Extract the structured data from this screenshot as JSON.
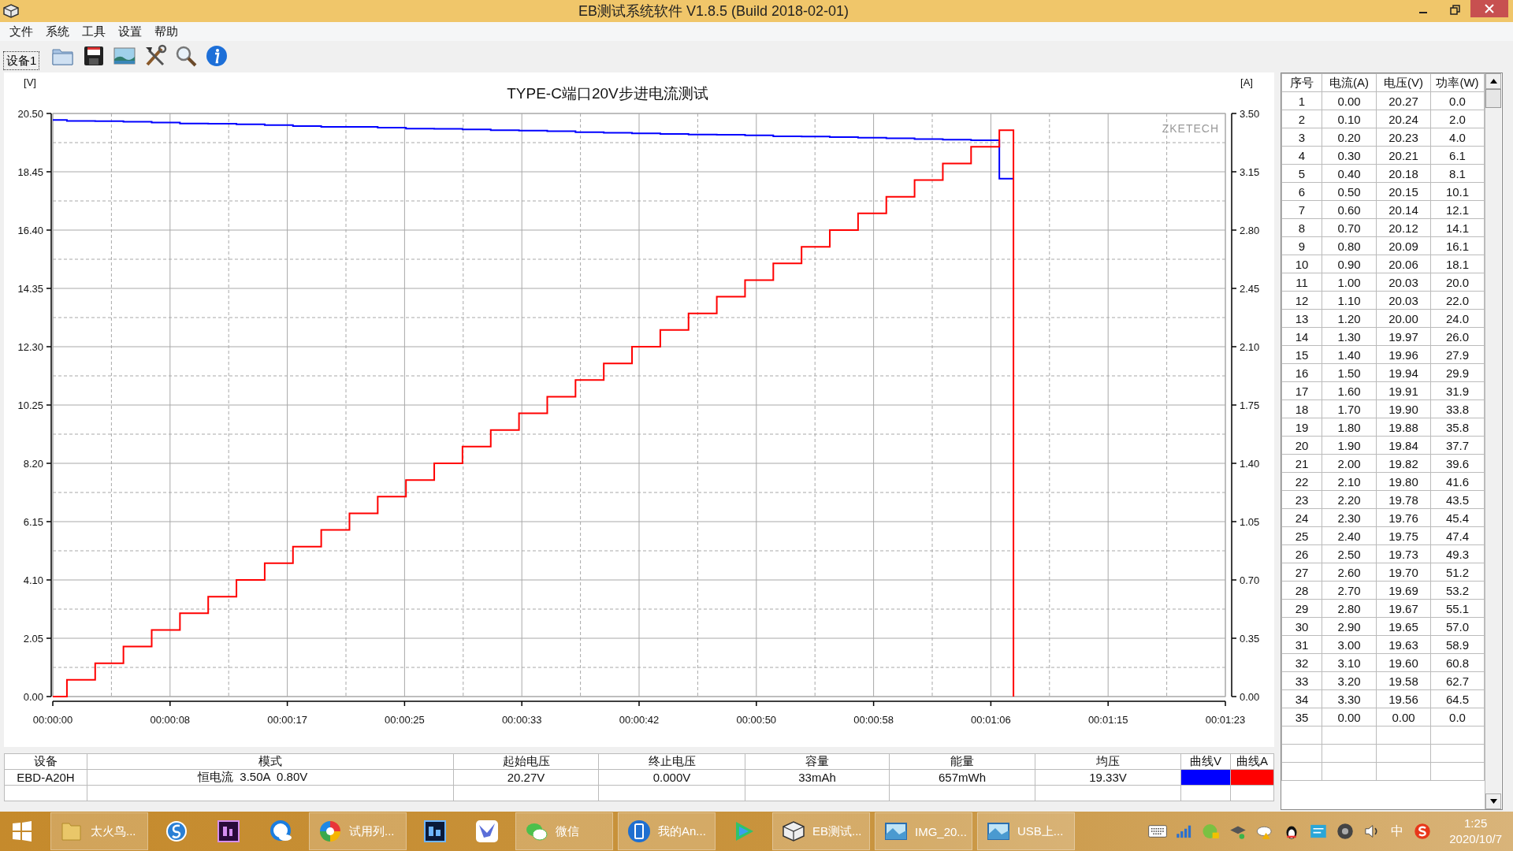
{
  "window": {
    "title": "EB测试系统软件 V1.8.5 (Build 2018-02-01)"
  },
  "menu": [
    "文件",
    "系统",
    "工具",
    "设置",
    "帮助"
  ],
  "toolbar": {
    "device_tab": "设备1"
  },
  "chart": {
    "brand": "ZKETECH",
    "chart_data": {
      "type": "line",
      "title": "TYPE-C端口20V步进电流测试",
      "ylabel": "[V]",
      "y2label": "[A]",
      "xlim": [
        0,
        83
      ],
      "ylim": [
        0,
        20.5
      ],
      "y2lim": [
        0,
        3.5
      ],
      "xticks": [
        {
          "value": 0,
          "label": "00:00:00"
        },
        {
          "value": 8.3,
          "label": "00:00:08"
        },
        {
          "value": 16.6,
          "label": "00:00:17"
        },
        {
          "value": 24.9,
          "label": "00:00:25"
        },
        {
          "value": 33.2,
          "label": "00:00:33"
        },
        {
          "value": 41.5,
          "label": "00:00:42"
        },
        {
          "value": 49.8,
          "label": "00:00:50"
        },
        {
          "value": 58.1,
          "label": "00:00:58"
        },
        {
          "value": 66.4,
          "label": "00:01:06"
        },
        {
          "value": 74.7,
          "label": "00:01:15"
        },
        {
          "value": 83,
          "label": "00:01:23"
        }
      ],
      "yticks": [
        {
          "value": 0,
          "label": "0.00"
        },
        {
          "value": 2.05,
          "label": "2.05"
        },
        {
          "value": 4.1,
          "label": "4.10"
        },
        {
          "value": 6.15,
          "label": "6.15"
        },
        {
          "value": 8.2,
          "label": "8.20"
        },
        {
          "value": 10.25,
          "label": "10.25"
        },
        {
          "value": 12.3,
          "label": "12.30"
        },
        {
          "value": 14.35,
          "label": "14.35"
        },
        {
          "value": 16.4,
          "label": "16.40"
        },
        {
          "value": 18.45,
          "label": "18.45"
        },
        {
          "value": 20.5,
          "label": "20.50"
        }
      ],
      "y2ticks": [
        {
          "value": 0,
          "label": "0.00"
        },
        {
          "value": 0.35,
          "label": "0.35"
        },
        {
          "value": 0.7,
          "label": "0.70"
        },
        {
          "value": 1.05,
          "label": "1.05"
        },
        {
          "value": 1.4,
          "label": "1.40"
        },
        {
          "value": 1.75,
          "label": "1.75"
        },
        {
          "value": 2.1,
          "label": "2.10"
        },
        {
          "value": 2.45,
          "label": "2.45"
        },
        {
          "value": 2.8,
          "label": "2.80"
        },
        {
          "value": 3.15,
          "label": "3.15"
        },
        {
          "value": 3.5,
          "label": "3.50"
        }
      ],
      "grid": true,
      "x": [
        0,
        1,
        1,
        3,
        3,
        5,
        5,
        7,
        7,
        9,
        9,
        11,
        11,
        13,
        13,
        15,
        15,
        17,
        17,
        19,
        19,
        21,
        21,
        23,
        23,
        25,
        25,
        27,
        27,
        29,
        29,
        31,
        31,
        33,
        33,
        35,
        35,
        37,
        37,
        39,
        39,
        41,
        41,
        43,
        43,
        45,
        45,
        47,
        47,
        49,
        49,
        51,
        51,
        53,
        53,
        55,
        55,
        57,
        57,
        59,
        59,
        61,
        61,
        63,
        63,
        65,
        65,
        67,
        67,
        68,
        68
      ],
      "series": [
        {
          "color": "#0000ff",
          "values": [
            20.27,
            20.27,
            20.24,
            20.24,
            20.23,
            20.23,
            20.21,
            20.21,
            20.18,
            20.18,
            20.15,
            20.15,
            20.14,
            20.14,
            20.12,
            20.12,
            20.09,
            20.09,
            20.06,
            20.06,
            20.03,
            20.03,
            20.03,
            20.03,
            20.0,
            20.0,
            19.97,
            19.97,
            19.96,
            19.96,
            19.94,
            19.94,
            19.91,
            19.91,
            19.9,
            19.9,
            19.88,
            19.88,
            19.84,
            19.84,
            19.82,
            19.82,
            19.8,
            19.8,
            19.78,
            19.78,
            19.76,
            19.76,
            19.75,
            19.75,
            19.73,
            19.73,
            19.7,
            19.7,
            19.69,
            19.69,
            19.67,
            19.67,
            19.65,
            19.65,
            19.63,
            19.63,
            19.6,
            19.6,
            19.58,
            19.58,
            19.56,
            19.56,
            18.21,
            18.21,
            18.21
          ]
        },
        {
          "axis": "y2",
          "color": "#ff0000",
          "values": [
            0,
            0,
            0.1,
            0.1,
            0.2,
            0.2,
            0.3,
            0.3,
            0.4,
            0.4,
            0.5,
            0.5,
            0.6,
            0.6,
            0.7,
            0.7,
            0.8,
            0.8,
            0.9,
            0.9,
            1.0,
            1.0,
            1.1,
            1.1,
            1.2,
            1.2,
            1.3,
            1.3,
            1.4,
            1.4,
            1.5,
            1.5,
            1.6,
            1.6,
            1.7,
            1.7,
            1.8,
            1.8,
            1.9,
            1.9,
            2.0,
            2.0,
            2.1,
            2.1,
            2.2,
            2.2,
            2.3,
            2.3,
            2.4,
            2.4,
            2.5,
            2.5,
            2.6,
            2.6,
            2.7,
            2.7,
            2.8,
            2.8,
            2.9,
            2.9,
            3.0,
            3.0,
            3.1,
            3.1,
            3.2,
            3.2,
            3.3,
            3.3,
            3.4,
            3.4,
            0
          ]
        }
      ]
    }
  },
  "summary": {
    "columns": [
      "设备",
      "模式",
      "起始电压",
      "终止电压",
      "容量",
      "能量",
      "均压",
      "曲线V",
      "曲线A"
    ],
    "row": {
      "device": "EBD-A20H",
      "mode": "恒电流  3.50A  0.80V",
      "start_voltage": "20.27V",
      "end_voltage": "0.000V",
      "capacity": "33mAh",
      "energy": "657mWh",
      "avg_voltage": "19.33V"
    },
    "curves": [
      {
        "color": "#0000ff"
      },
      {
        "color": "#ff0000"
      }
    ]
  },
  "readings": {
    "columns": [
      "序号",
      "电流(A)",
      "电压(V)",
      "功率(W)"
    ],
    "rows": [
      [
        "1",
        "0.00",
        "20.27",
        "0.0"
      ],
      [
        "2",
        "0.10",
        "20.24",
        "2.0"
      ],
      [
        "3",
        "0.20",
        "20.23",
        "4.0"
      ],
      [
        "4",
        "0.30",
        "20.21",
        "6.1"
      ],
      [
        "5",
        "0.40",
        "20.18",
        "8.1"
      ],
      [
        "6",
        "0.50",
        "20.15",
        "10.1"
      ],
      [
        "7",
        "0.60",
        "20.14",
        "12.1"
      ],
      [
        "8",
        "0.70",
        "20.12",
        "14.1"
      ],
      [
        "9",
        "0.80",
        "20.09",
        "16.1"
      ],
      [
        "10",
        "0.90",
        "20.06",
        "18.1"
      ],
      [
        "11",
        "1.00",
        "20.03",
        "20.0"
      ],
      [
        "12",
        "1.10",
        "20.03",
        "22.0"
      ],
      [
        "13",
        "1.20",
        "20.00",
        "24.0"
      ],
      [
        "14",
        "1.30",
        "19.97",
        "26.0"
      ],
      [
        "15",
        "1.40",
        "19.96",
        "27.9"
      ],
      [
        "16",
        "1.50",
        "19.94",
        "29.9"
      ],
      [
        "17",
        "1.60",
        "19.91",
        "31.9"
      ],
      [
        "18",
        "1.70",
        "19.90",
        "33.8"
      ],
      [
        "19",
        "1.80",
        "19.88",
        "35.8"
      ],
      [
        "20",
        "1.90",
        "19.84",
        "37.7"
      ],
      [
        "21",
        "2.00",
        "19.82",
        "39.6"
      ],
      [
        "22",
        "2.10",
        "19.80",
        "41.6"
      ],
      [
        "23",
        "2.20",
        "19.78",
        "43.5"
      ],
      [
        "24",
        "2.30",
        "19.76",
        "45.4"
      ],
      [
        "25",
        "2.40",
        "19.75",
        "47.4"
      ],
      [
        "26",
        "2.50",
        "19.73",
        "49.3"
      ],
      [
        "27",
        "2.60",
        "19.70",
        "51.2"
      ],
      [
        "28",
        "2.70",
        "19.69",
        "53.2"
      ],
      [
        "29",
        "2.80",
        "19.67",
        "55.1"
      ],
      [
        "30",
        "2.90",
        "19.65",
        "57.0"
      ],
      [
        "31",
        "3.00",
        "19.63",
        "58.9"
      ],
      [
        "32",
        "3.10",
        "19.60",
        "60.8"
      ],
      [
        "33",
        "3.20",
        "19.58",
        "62.7"
      ],
      [
        "34",
        "3.30",
        "19.56",
        "64.5"
      ],
      [
        "35",
        "0.00",
        "0.00",
        "0.0"
      ]
    ]
  },
  "taskbar": {
    "items": [
      {
        "kind": "start"
      },
      {
        "kind": "window",
        "label": "太火鸟..."
      },
      {
        "kind": "pinned"
      },
      {
        "kind": "pinned"
      },
      {
        "kind": "pinned"
      },
      {
        "kind": "window",
        "label": "试用列..."
      },
      {
        "kind": "pinned"
      },
      {
        "kind": "pinned"
      },
      {
        "kind": "window",
        "label": "微信"
      },
      {
        "kind": "window",
        "label": "我的An..."
      },
      {
        "kind": "pinned"
      },
      {
        "kind": "window",
        "label": "EB测试..."
      },
      {
        "kind": "window",
        "label": "IMG_20..."
      },
      {
        "kind": "window",
        "label": "USB上..."
      }
    ],
    "ime": "中",
    "time": "1:25",
    "date": "2020/10/7"
  }
}
